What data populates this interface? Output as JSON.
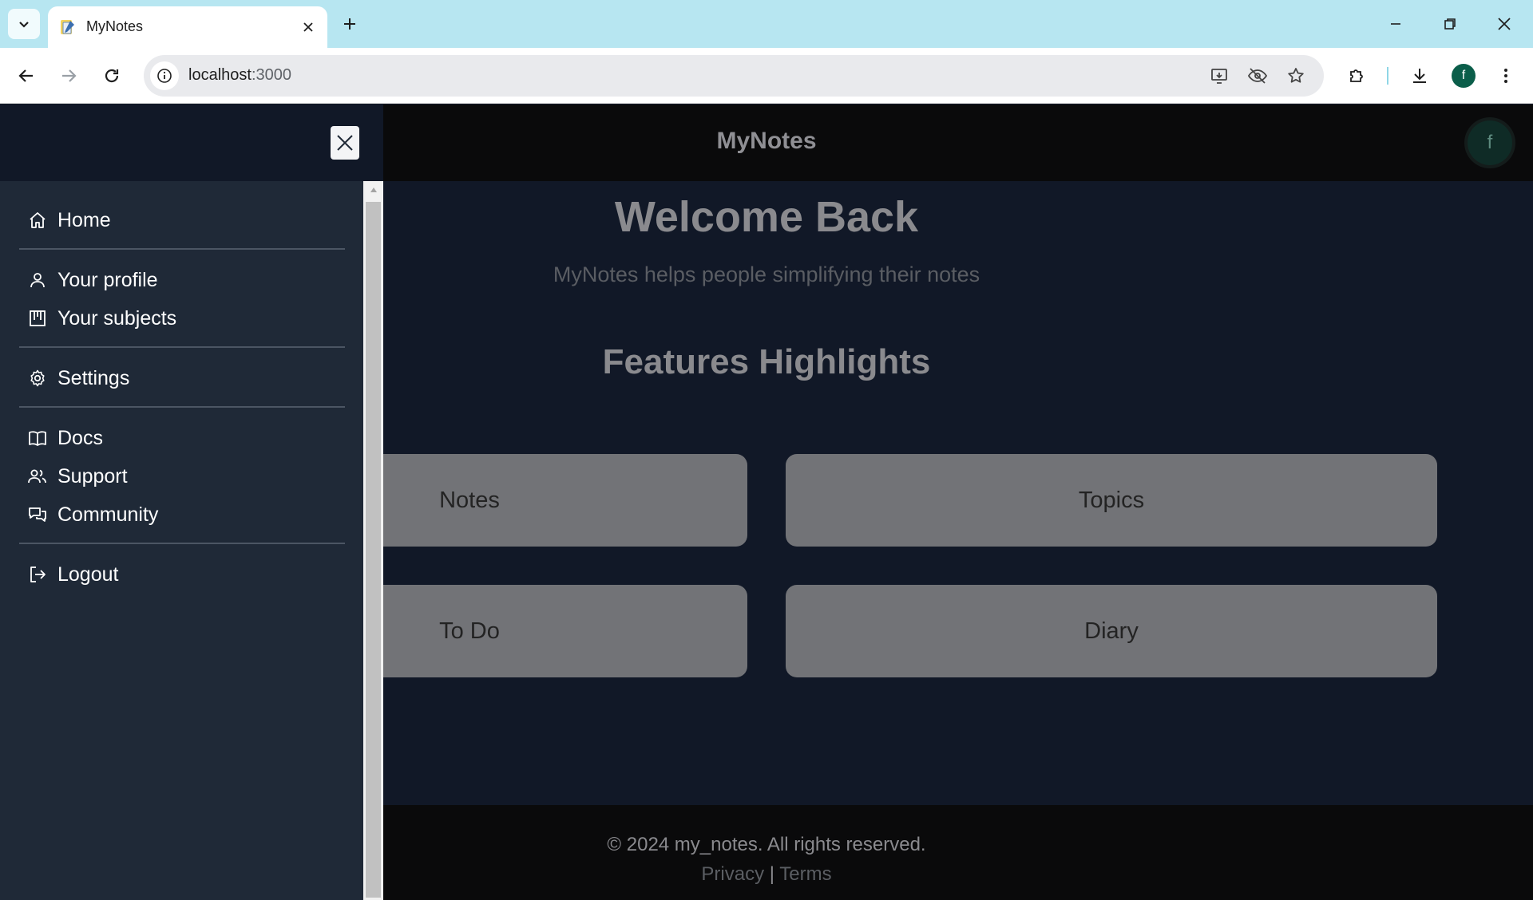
{
  "browser": {
    "tab_title": "MyNotes",
    "url_host": "localhost",
    "url_port": ":3000",
    "profile_initial": "f"
  },
  "app": {
    "brand": "MyNotes",
    "avatar_initial": "f",
    "hero_title": "Welcome Back",
    "hero_subtitle": "MyNotes helps people simplifying their notes",
    "features_title": "Features Highlights",
    "cards": [
      "Notes",
      "Topics",
      "To Do",
      "Diary"
    ],
    "footer_copyright": "© 2024 my_notes. All rights reserved.",
    "footer_privacy": "Privacy",
    "footer_separator": "|",
    "footer_terms": "Terms"
  },
  "drawer": {
    "items": [
      {
        "label": "Home",
        "icon": "home-icon"
      },
      {
        "label": "Your profile",
        "icon": "user-icon"
      },
      {
        "label": "Your subjects",
        "icon": "board-icon"
      },
      {
        "label": "Settings",
        "icon": "gear-icon"
      },
      {
        "label": "Docs",
        "icon": "book-icon"
      },
      {
        "label": "Support",
        "icon": "users-icon"
      },
      {
        "label": "Community",
        "icon": "chat-icon"
      },
      {
        "label": "Logout",
        "icon": "logout-icon"
      }
    ]
  },
  "colors": {
    "drawer_bg": "#1f2937",
    "page_bg": "#111827",
    "card_bg": "#727377",
    "tabstrip_bg": "#b7e6f1",
    "profile_green": "#0b5e4a"
  }
}
